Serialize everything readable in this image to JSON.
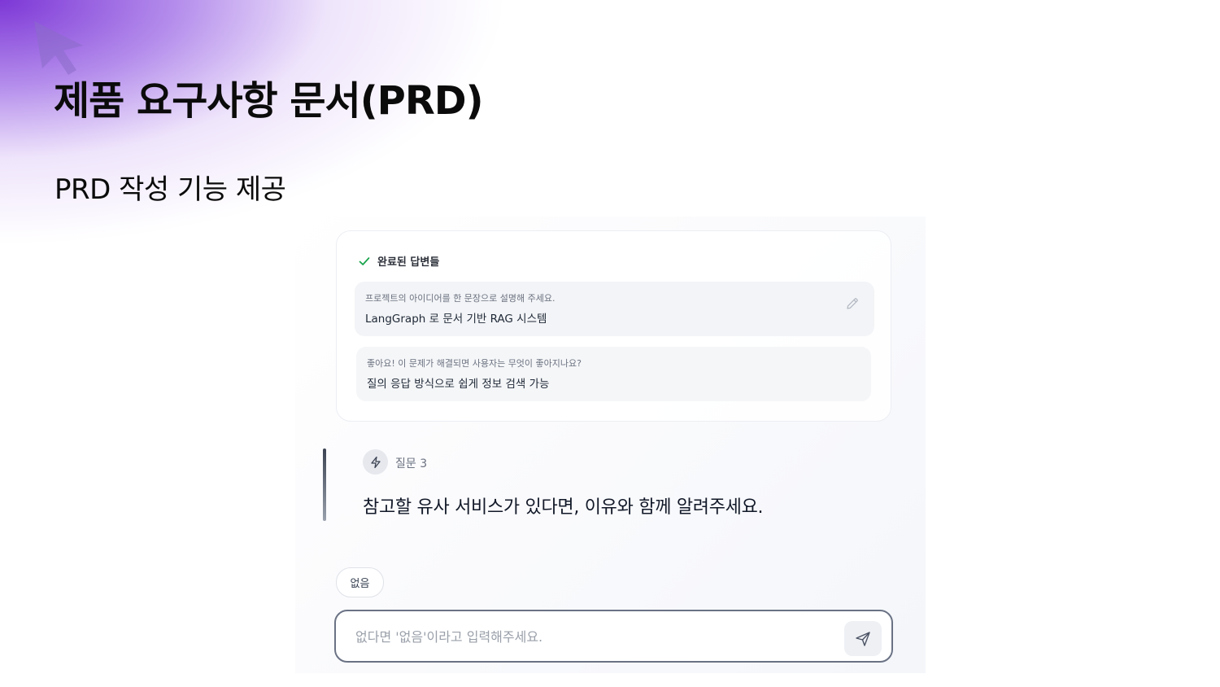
{
  "slide": {
    "title": "제품 요구사항 문서(PRD)",
    "subtitle": "PRD 작성 기능 제공"
  },
  "colors": {
    "accent_gradient": "#762cd4",
    "check": "#16a34a",
    "input_border": "#6a7284"
  },
  "answers": {
    "header": "완료된 답변들",
    "items": [
      {
        "question": "프로젝트의 아이디어를 한 문장으로 설명해 주세요.",
        "answer": "LangGraph 로 문서 기반 RAG 시스템",
        "icon": "pencil-icon"
      },
      {
        "question": "좋아요! 이 문제가 해결되면 사용자는 무엇이 좋아지나요?",
        "answer": "질의 응답 방식으로 쉽게 정보 검색 가능"
      }
    ]
  },
  "current_question": {
    "label": "질문 3",
    "text": "참고할 유사 서비스가 있다면, 이유와 함께 알려주세요.",
    "icon": "bolt-icon"
  },
  "suggestion_chip": "없음",
  "input": {
    "placeholder": "없다면 '없음'이라고 입력해주세요.",
    "value": "",
    "send_icon": "send-icon"
  }
}
